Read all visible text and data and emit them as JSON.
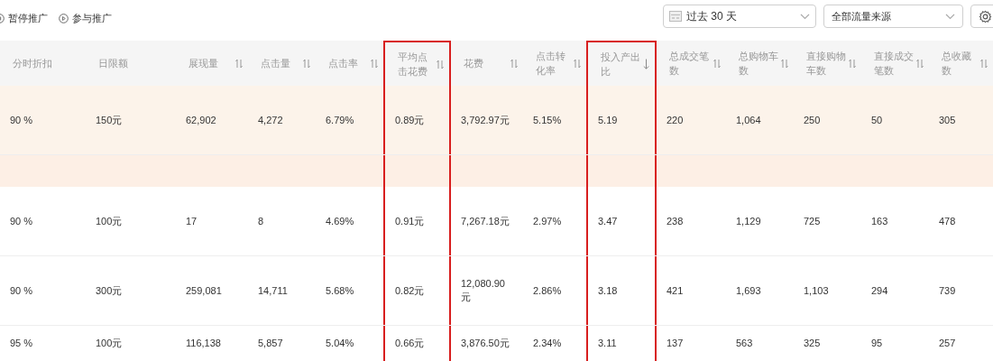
{
  "toolbar": {
    "actions": [
      {
        "label": "暂停推广",
        "kind": "pause"
      },
      {
        "label": "参与推广",
        "kind": "play"
      }
    ],
    "date_select": {
      "value": "过去 30 天"
    },
    "source_select": {
      "value": "全部流量来源"
    }
  },
  "table": {
    "columns": [
      {
        "label": "分时折扣",
        "sortable": false,
        "highlighted": false
      },
      {
        "label": "日限额",
        "sortable": false,
        "highlighted": false
      },
      {
        "label": "展现量",
        "sortable": true,
        "sorted": false,
        "highlighted": false
      },
      {
        "label": "点击量",
        "sortable": true,
        "sorted": false,
        "highlighted": false
      },
      {
        "label": "点击率",
        "sortable": true,
        "sorted": false,
        "highlighted": false
      },
      {
        "label": "平均点击花费",
        "sortable": true,
        "sorted": false,
        "highlighted": true
      },
      {
        "label": "花费",
        "sortable": true,
        "sorted": false,
        "highlighted": false
      },
      {
        "label": "点击转化率",
        "sortable": true,
        "sorted": false,
        "highlighted": false
      },
      {
        "label": "投入产出比",
        "sortable": true,
        "sorted": true,
        "highlighted": true
      },
      {
        "label": "总成交笔数",
        "sortable": true,
        "sorted": false,
        "highlighted": false
      },
      {
        "label": "总购物车数",
        "sortable": true,
        "sorted": false,
        "highlighted": false
      },
      {
        "label": "直接购物车数",
        "sortable": true,
        "sorted": false,
        "highlighted": false
      },
      {
        "label": "直接成交笔数",
        "sortable": true,
        "sorted": false,
        "highlighted": false
      },
      {
        "label": "总收藏数",
        "sortable": true,
        "sorted": false,
        "highlighted": false
      }
    ],
    "rows": [
      {
        "expanded": true,
        "cells": [
          "90 %",
          "150元",
          "62,902",
          "4,272",
          "6.79%",
          "0.89元",
          "3,792.97元",
          "5.15%",
          "5.19",
          "220",
          "1,064",
          "250",
          "50",
          "305"
        ]
      },
      {
        "expanded": false,
        "cells": [
          "90 %",
          "100元",
          "17",
          "8",
          "4.69%",
          "0.91元",
          "7,267.18元",
          "2.97%",
          "3.47",
          "238",
          "1,129",
          "725",
          "163",
          "478"
        ]
      },
      {
        "expanded": false,
        "cells": [
          "90 %",
          "300元",
          "259,081",
          "14,711",
          "5.68%",
          "0.82元",
          "12,080.90元",
          "2.86%",
          "3.18",
          "421",
          "1,693",
          "1,103",
          "294",
          "739"
        ]
      },
      {
        "expanded": false,
        "cells": [
          "95 %",
          "100元",
          "116,138",
          "5,857",
          "5.04%",
          "0.66元",
          "3,876.50元",
          "2.34%",
          "3.11",
          "137",
          "563",
          "325",
          "95",
          "257"
        ]
      }
    ]
  }
}
